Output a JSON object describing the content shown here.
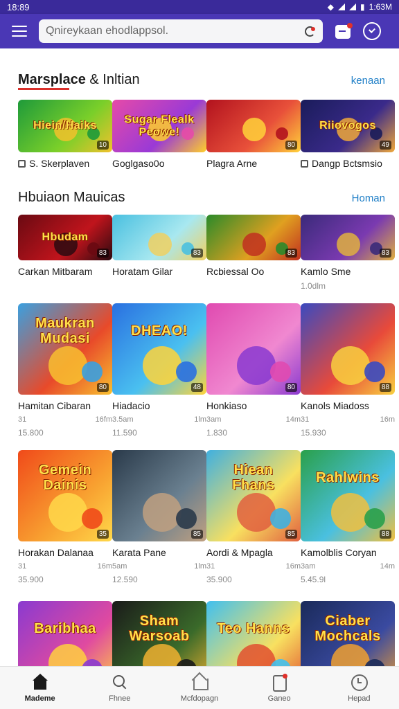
{
  "status_bar": {
    "time": "18:89",
    "right": "1:63M"
  },
  "search": {
    "placeholder": "Qnireykaan ehodlappsol."
  },
  "section1": {
    "title_bold": "Marsplace",
    "title_rest": " & Inltian",
    "more": "kenaan",
    "items": [
      {
        "title": "S. Skerplaven",
        "art": "Hiein/Haiks",
        "badge": "10",
        "colors": [
          "#1e9a3a",
          "#7acf2a",
          "#f2c12c"
        ]
      },
      {
        "title": "Goglgaso0o",
        "art": "Sugar Flealk Peowe!",
        "badge": "",
        "colors": [
          "#e64aa8",
          "#9a3ad6",
          "#ffcf2a"
        ]
      },
      {
        "title": "Plagra Arne",
        "art": "",
        "badge": "80",
        "colors": [
          "#b2121e",
          "#e8503a",
          "#ffd23a"
        ]
      },
      {
        "title": "Dangp Bctsmsio",
        "art": "Riiovogos",
        "badge": "49",
        "colors": [
          "#1a1c5a",
          "#3a2a8a",
          "#f0a83a"
        ]
      }
    ]
  },
  "section2": {
    "title": "Hbuiaon Mauicas",
    "more": "Homan",
    "row1": [
      {
        "title": "Carkan Mitbaram",
        "sub": "",
        "art": "Hbudam",
        "badge": "83",
        "colors": [
          "#6a0a12",
          "#c0141c",
          "#2a0a10"
        ]
      },
      {
        "title": "Horatam Gilar",
        "sub": "",
        "art": "",
        "badge": "83",
        "colors": [
          "#4ac0e0",
          "#a8e8f0",
          "#f0d060"
        ]
      },
      {
        "title": "Rcbiessal Oo",
        "sub": "",
        "art": "",
        "badge": "83",
        "colors": [
          "#2a8a2a",
          "#e0a020",
          "#c03020"
        ]
      },
      {
        "title": "Kamlo Sme",
        "sub": "1.0dlm",
        "art": "",
        "badge": "83",
        "colors": [
          "#3a2a7a",
          "#7a3ab0",
          "#e0b040"
        ]
      }
    ],
    "row2": [
      {
        "title": "Hamitan Cibaran",
        "m1": "31",
        "m2": "16fm",
        "m3": "15.800",
        "art": "Maukran Mudasi",
        "badge": "80",
        "colors": [
          "#3aa0e0",
          "#e84a2a",
          "#f8c030"
        ]
      },
      {
        "title": "Hiadacio",
        "m1": "3.5am",
        "m2": "1lm",
        "m3": "11.590",
        "art": "DHEAO!",
        "badge": "48",
        "colors": [
          "#2a70e0",
          "#4ac0f0",
          "#ffd43a"
        ]
      },
      {
        "title": "Honkiaso",
        "m1": "3am",
        "m2": "14m",
        "m3": "1.830",
        "art": "",
        "badge": "80",
        "colors": [
          "#e04ab0",
          "#f088d0",
          "#8a3ad0"
        ]
      },
      {
        "title": "Kanols Miadoss",
        "m1": "31",
        "m2": "16m",
        "m3": "15.930",
        "art": "",
        "badge": "88",
        "colors": [
          "#3a4ac0",
          "#e84a3a",
          "#f8d040"
        ]
      }
    ],
    "row3": [
      {
        "title": "Horakan Dalanaa",
        "m1": "31",
        "m2": "16m",
        "m3": "35.900",
        "art": "Gemein Dainis",
        "badge": "35",
        "colors": [
          "#f04a1a",
          "#f8a030",
          "#ffd84a"
        ]
      },
      {
        "title": "Karata Pane",
        "m1": "5am",
        "m2": "1lm",
        "m3": "12.590",
        "art": "",
        "badge": "85",
        "colors": [
          "#2a3a4a",
          "#6a8090",
          "#c0a080"
        ]
      },
      {
        "title": "Aordi & Mpagla",
        "m1": "31",
        "m2": "16m",
        "m3": "35.900",
        "art": "Hiean Fhans",
        "badge": "85",
        "colors": [
          "#40b0e0",
          "#f8e060",
          "#e06040"
        ]
      },
      {
        "title": "Kamolblis Coryan",
        "m1": "3am",
        "m2": "14m",
        "m3": "5.45.9l",
        "art": "Rahlwins",
        "badge": "88",
        "colors": [
          "#2aa04a",
          "#4ac0e0",
          "#f0c040"
        ]
      }
    ],
    "row4": [
      {
        "art": "Baribhaa",
        "colors": [
          "#8a3ad0",
          "#e04aa0",
          "#ffd040"
        ]
      },
      {
        "art": "Sham Warsoab",
        "colors": [
          "#1a1a1a",
          "#3a6a2a",
          "#f0b030"
        ]
      },
      {
        "art": "Teo Hanns",
        "colors": [
          "#40c0f0",
          "#f8e060",
          "#e05030"
        ]
      },
      {
        "art": "Ciaber Mochcals",
        "colors": [
          "#1a2a5a",
          "#3a4aa0",
          "#f0a030"
        ]
      }
    ]
  },
  "nav": [
    {
      "label": "Mademe",
      "icon": "home-icon",
      "active": true
    },
    {
      "label": "Fhnee",
      "icon": "search-icon",
      "active": false
    },
    {
      "label": "Mcfdopagn",
      "icon": "market-icon",
      "active": false
    },
    {
      "label": "Ganeo",
      "icon": "games-icon",
      "active": false
    },
    {
      "label": "Hepad",
      "icon": "clock-icon",
      "active": false
    }
  ]
}
